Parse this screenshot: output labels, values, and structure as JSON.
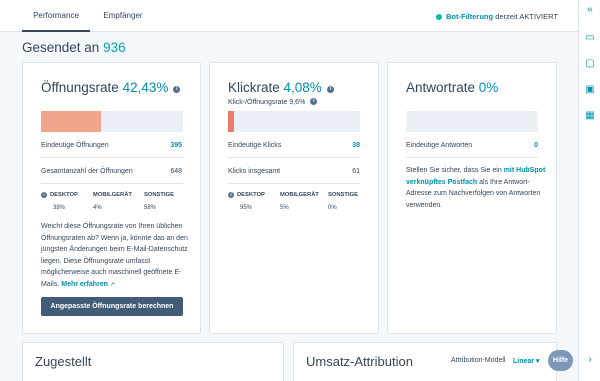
{
  "tabs": [
    {
      "label": "Performance",
      "active": true
    },
    {
      "label": "Empfänger",
      "active": false
    }
  ],
  "bot_filter": {
    "link": "Bot-Filterung",
    "status": "derzeit AKTIVIERT"
  },
  "sent": {
    "label": "Gesendet an",
    "count": "936"
  },
  "open_rate": {
    "title": "Öffnungsrate",
    "percent": "42,43%",
    "bar_fill": 0.4243,
    "unique_label": "Eindeutige Öffnungen",
    "unique_value": "395",
    "total_label": "Gesamtanzahl der Öffnungen",
    "total_value": "648",
    "devices": [
      {
        "label": "DESKTOP",
        "value": "38%"
      },
      {
        "label": "MOBILGERÄT",
        "value": "4%"
      },
      {
        "label": "SONSTIGE",
        "value": "58%"
      }
    ],
    "text": "Weicht diese Öffnungsrate von Ihren üblichen Öffnungsraten ab? Wenn ja, könnte das an den jüngsten Änderungen beim E-Mail-Datenschutz liegen. Diese Öffnungsrate umfasst möglicherweise auch maschinell geöffnete E-Mails.",
    "learn_more": "Mehr erfahren",
    "button": "Angepasste Öffnungsrate berechnen"
  },
  "click_rate": {
    "title": "Klickrate",
    "percent": "4,08%",
    "sub": "Klick-/Öffnungsrate 9,6%",
    "bar_fill": 0.0408,
    "unique_label": "Eindeutige Klicks",
    "unique_value": "38",
    "total_label": "Klicks insgesamt",
    "total_value": "61",
    "devices": [
      {
        "label": "DESKTOP",
        "value": "95%"
      },
      {
        "label": "MOBILGERÄT",
        "value": "5%"
      },
      {
        "label": "SONSTIGE",
        "value": "0%"
      }
    ]
  },
  "reply_rate": {
    "title": "Antwortrate",
    "percent": "0%",
    "unique_label": "Eindeutige Antworten",
    "unique_value": "0",
    "text_before": "Stellen Sie sicher, dass Sie ein",
    "text_link": "mit HubSpot verknüpftes Postfach",
    "text_after": "als Ihre Antwort-Adresse zum Nachverfolgen von Antworten verwenden."
  },
  "delivered": {
    "title": "Zugestellt"
  },
  "revenue": {
    "title": "Umsatz-Attribution",
    "model_label": "Attribution-Modell",
    "model_value": "Linear"
  },
  "help": {
    "label": "Hilfe"
  },
  "colors": {
    "accent": "#0091ae",
    "open_fill": "#f2a48d",
    "click_fill": "#f07a6a",
    "button": "#425b76"
  }
}
